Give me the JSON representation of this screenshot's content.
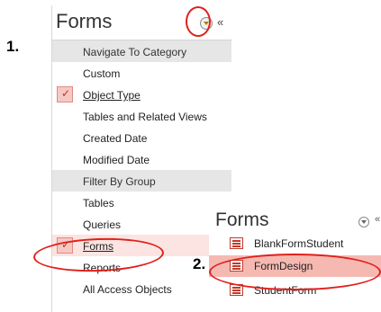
{
  "annotations": {
    "step1": "1.",
    "step2": "2."
  },
  "pane": {
    "title": "Forms",
    "menu": [
      {
        "label": "Navigate To Category",
        "type": "header"
      },
      {
        "label": "Custom",
        "type": "item"
      },
      {
        "label": "Object Type",
        "type": "item",
        "checked": true
      },
      {
        "label": "Tables and Related Views",
        "type": "item"
      },
      {
        "label": "Created Date",
        "type": "item"
      },
      {
        "label": "Modified Date",
        "type": "item"
      },
      {
        "label": "Filter By Group",
        "type": "header"
      },
      {
        "label": "Tables",
        "type": "item"
      },
      {
        "label": "Queries",
        "type": "item"
      },
      {
        "label": "Forms",
        "type": "item",
        "checked": true
      },
      {
        "label": "Reports",
        "type": "item"
      },
      {
        "label": "All Access Objects",
        "type": "item"
      }
    ]
  },
  "forms_panel": {
    "title": "Forms",
    "items": [
      {
        "label": "BlankFormStudent"
      },
      {
        "label": "FormDesign",
        "selected": true
      },
      {
        "label": "StudentForm"
      }
    ]
  },
  "colors": {
    "annotation_red": "#e0201b",
    "check_bg": "#f5c9c3",
    "selected_bg": "#f5b9b2"
  }
}
